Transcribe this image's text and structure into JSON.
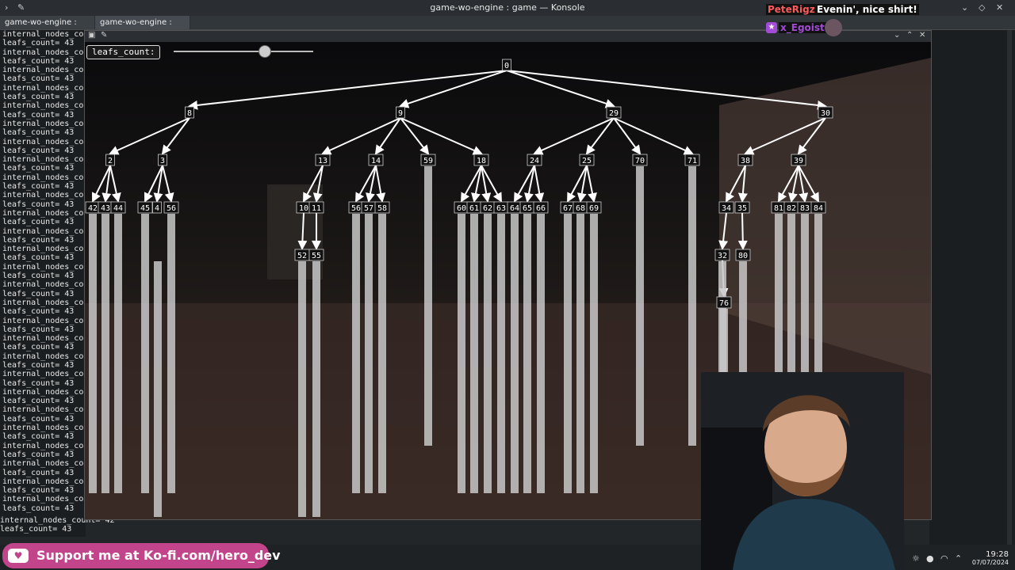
{
  "window_title": "game-wo-engine : game — Konsole",
  "tabs": [
    {
      "label": "game-wo-engine : nvim",
      "close": "×"
    },
    {
      "label": "game-wo-engine : game",
      "close": "×"
    }
  ],
  "terminal": {
    "line_a": "internal_nodes_co",
    "line_b": "leafs_count= 43",
    "tail_line": "internal_nodes_count= 42",
    "last_line": "leafs_count= 43"
  },
  "slider": {
    "label": "leafs_count:",
    "level": 0.65
  },
  "tree": {
    "root": "0",
    "level1": [
      "8",
      "9",
      "29",
      "30"
    ],
    "level2": [
      "2",
      "3",
      "13",
      "14",
      "59",
      "18",
      "24",
      "25",
      "70",
      "71",
      "38",
      "39"
    ],
    "level3": [
      "42",
      "43",
      "44",
      "45",
      "4",
      "56",
      "10",
      "11",
      "56",
      "57",
      "58",
      "60",
      "61",
      "62",
      "63",
      "64",
      "65",
      "66",
      "67",
      "68",
      "69",
      "34",
      "35",
      "81",
      "82",
      "83",
      "84"
    ],
    "level4": [
      "52",
      "55",
      "32",
      "80"
    ],
    "level5": [
      "76"
    ]
  },
  "chat": [
    {
      "user": "PeteRigz",
      "message": "Evenin', nice shirt!"
    },
    {
      "user": "x_Egoist",
      "message": ""
    }
  ],
  "kofi": {
    "text": "Support me at Ko-fi.com/hero_dev",
    "icon": "kofi-heart-icon"
  },
  "clock": {
    "time": "19:28",
    "date": "07/07/2024"
  },
  "colors": {
    "kofi": "#c2448b",
    "chat_user1": "#ff5a5a",
    "chat_user2": "#a24bd6"
  }
}
